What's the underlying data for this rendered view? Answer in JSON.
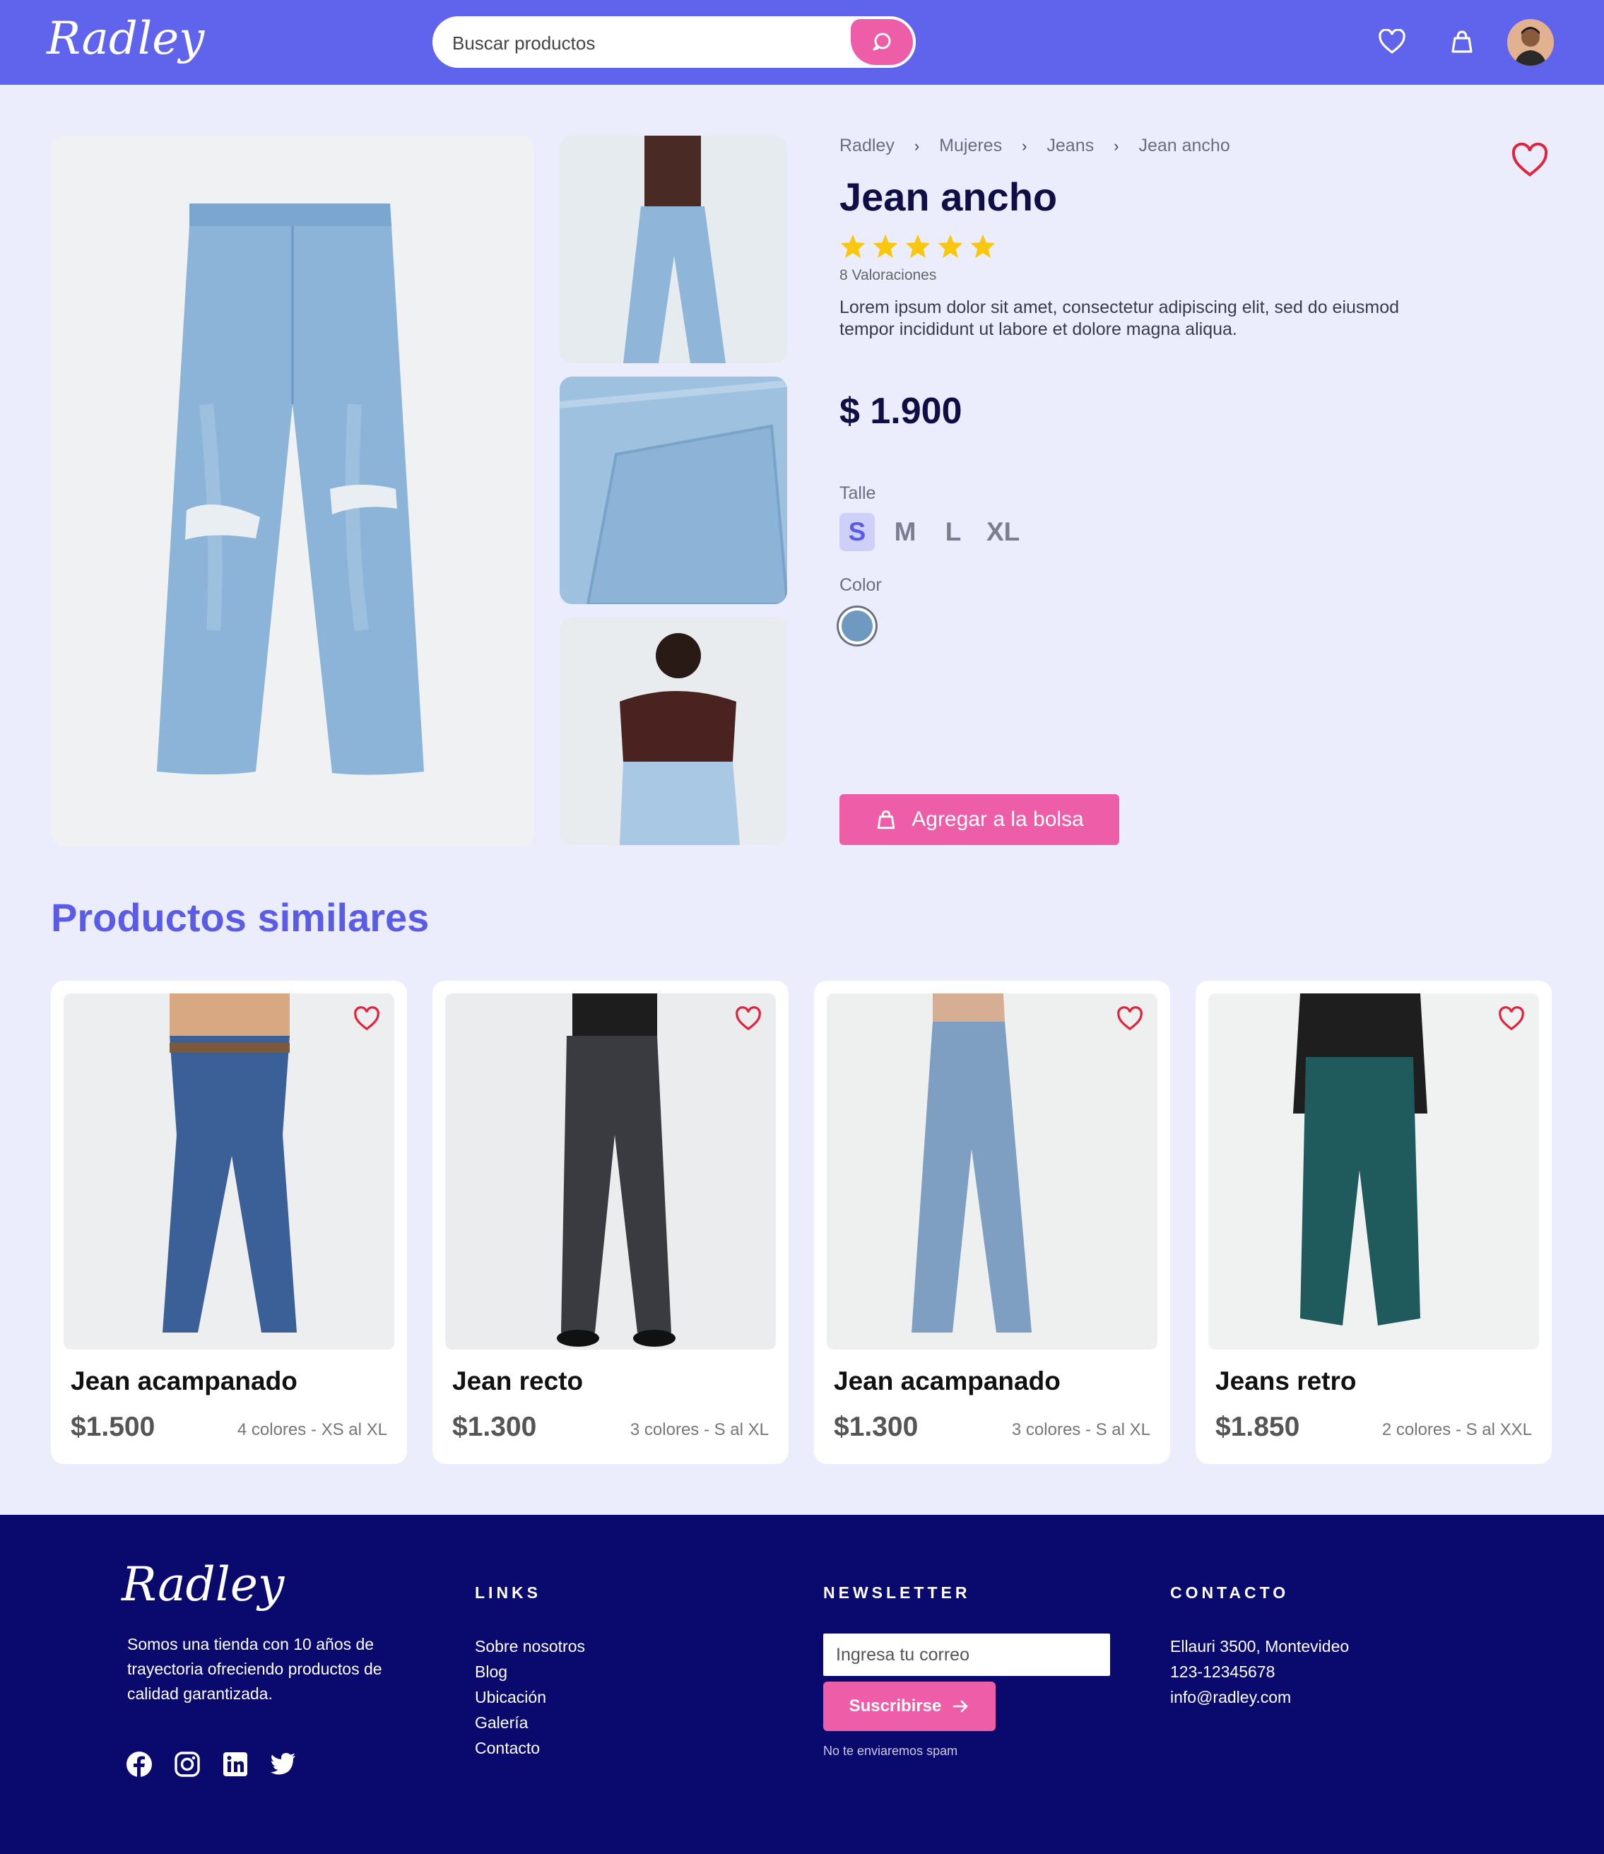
{
  "header": {
    "logo": "Radley",
    "search_placeholder": "Buscar productos"
  },
  "breadcrumb": [
    "Radley",
    "Mujeres",
    "Jeans",
    "Jean ancho"
  ],
  "product": {
    "title": "Jean ancho",
    "rating": 5,
    "rating_count": "8 Valoraciones",
    "description": "Lorem ipsum dolor sit amet, consectetur adipiscing elit, sed do eiusmod tempor incididunt ut labore et dolore magna aliqua.",
    "price": "$ 1.900",
    "size_label": "Talle",
    "sizes": [
      "S",
      "M",
      "L",
      "XL"
    ],
    "selected_size": "S",
    "color_label": "Color",
    "color": "#6f99c0",
    "add_to_bag": "Agregar a la bolsa"
  },
  "similar": {
    "title": "Productos similares",
    "items": [
      {
        "name": "Jean acampanado",
        "price": "$1.500",
        "meta": "4 colores - XS al XL"
      },
      {
        "name": "Jean recto",
        "price": "$1.300",
        "meta": "3 colores - S al XL"
      },
      {
        "name": "Jean acampanado",
        "price": "$1.300",
        "meta": "3 colores - S al XL"
      },
      {
        "name": "Jeans retro",
        "price": "$1.850",
        "meta": "2 colores - S al XXL"
      }
    ]
  },
  "footer": {
    "logo": "Radley",
    "about": "Somos una tienda con 10 años de trayectoria ofreciendo productos de calidad garantizada.",
    "links_title": "LINKS",
    "links": [
      "Sobre nosotros",
      "Blog",
      "Ubicación",
      "Galería",
      "Contacto"
    ],
    "newsletter_title": "NEWSLETTER",
    "newsletter_placeholder": "Ingresa tu correo",
    "subscribe": "Suscribirse",
    "no_spam": "No te enviaremos spam",
    "contact_title": "CONTACTO",
    "contact": [
      "Ellauri 3500, Montevideo",
      "123-12345678",
      "info@radley.com"
    ]
  },
  "colors": {
    "brand": "#6063ec",
    "accent": "#ee5ea8",
    "footer_bg": "#0a0a6e",
    "heading": "#5a5ce6",
    "favorite": "#e0243c",
    "star": "#f9c80e"
  },
  "icons": [
    "search-icon",
    "heart-icon",
    "bag-icon",
    "facebook-icon",
    "instagram-icon",
    "linkedin-icon",
    "twitter-icon",
    "star-icon",
    "chevron-right-icon",
    "arrow-right-icon"
  ]
}
